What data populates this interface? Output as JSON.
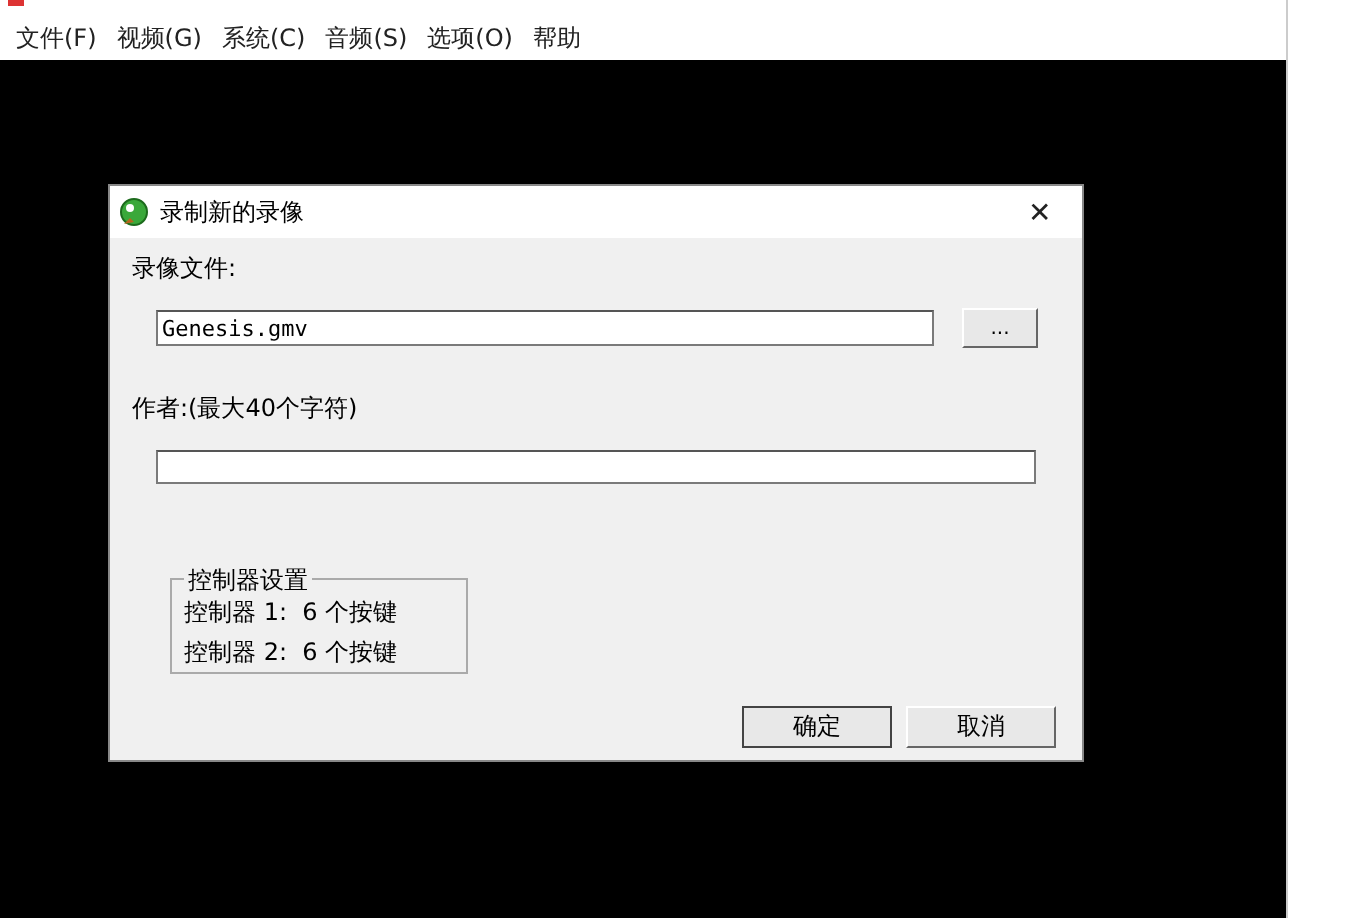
{
  "menu": [
    {
      "label": "文件(F)"
    },
    {
      "label": "视频(G)"
    },
    {
      "label": "系统(C)"
    },
    {
      "label": "音频(S)"
    },
    {
      "label": "选项(O)"
    },
    {
      "label": "帮助"
    }
  ],
  "dialog": {
    "title": "录制新的录像",
    "close": "✕",
    "file_label": "录像文件:",
    "file_value": "Genesis.gmv",
    "browse": "...",
    "author_label": "作者:(最大40个字符)",
    "group": {
      "legend": "控制器设置",
      "lines": [
        "控制器 1:  6 个按键",
        "控制器 2:  6 个按键"
      ]
    },
    "buttons": [
      {
        "label": "确定",
        "default": true
      },
      {
        "label": "取消",
        "default": false
      }
    ]
  }
}
